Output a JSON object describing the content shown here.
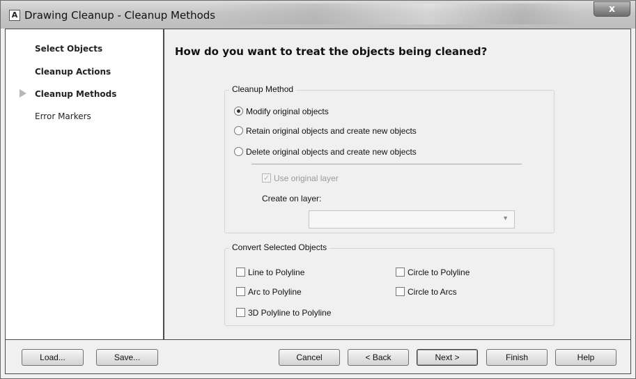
{
  "window": {
    "title": "Drawing Cleanup - Cleanup Methods",
    "app_icon_glyph": "A",
    "close_glyph": "x"
  },
  "sidebar": {
    "items": [
      {
        "label": "Select Objects",
        "bold": true,
        "current": false
      },
      {
        "label": "Cleanup Actions",
        "bold": true,
        "current": false
      },
      {
        "label": "Cleanup Methods",
        "bold": true,
        "current": true
      },
      {
        "label": "Error Markers",
        "bold": false,
        "current": false
      }
    ],
    "current_marker_icon": "triangle-right-icon"
  },
  "main": {
    "heading": "How do you want to treat the objects being cleaned?",
    "cleanup_method": {
      "title": "Cleanup Method",
      "options": [
        {
          "label": "Modify original objects",
          "selected": true
        },
        {
          "label": "Retain original objects and create new objects",
          "selected": false
        },
        {
          "label": "Delete original objects and create new objects",
          "selected": false
        }
      ],
      "use_original_layer": {
        "label": "Use original layer",
        "checked": true,
        "enabled": false
      },
      "create_on_layer": {
        "label": "Create on layer:",
        "value": "",
        "enabled": false
      }
    },
    "convert_selected": {
      "title": "Convert Selected Objects",
      "options": [
        {
          "label": "Line to Polyline",
          "checked": false
        },
        {
          "label": "Circle to Polyline",
          "checked": false
        },
        {
          "label": "Arc to Polyline",
          "checked": false
        },
        {
          "label": "Circle to Arcs",
          "checked": false
        },
        {
          "label": "3D Polyline to Polyline",
          "checked": false
        }
      ]
    }
  },
  "footer": {
    "load": "Load...",
    "save": "Save...",
    "cancel": "Cancel",
    "back": "< Back",
    "next": "Next >",
    "finish": "Finish",
    "help": "Help"
  }
}
